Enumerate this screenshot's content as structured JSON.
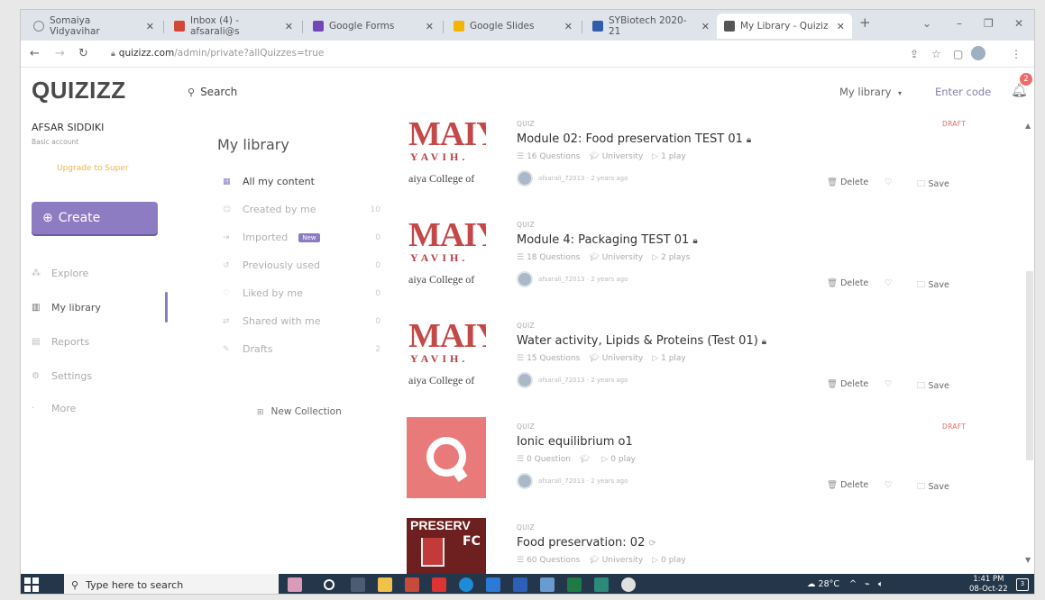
{
  "browser": {
    "tabs": [
      {
        "label": "Somaiya Vidyavihar",
        "color": "#888888"
      },
      {
        "label": "Inbox (4) - afsarali@s",
        "color": "#d44638"
      },
      {
        "label": "Google Forms",
        "color": "#7248b9"
      },
      {
        "label": "Google Slides",
        "color": "#f4b400"
      },
      {
        "label": "SYBiotech 2020-21",
        "color": "#2f5fa8"
      },
      {
        "label": "My Library - Quiziz",
        "color": "#555555"
      }
    ],
    "url_host": "quizizz.com",
    "url_path": "/admin/private?allQuizzes=true"
  },
  "header": {
    "logo": "QUIZIZZ",
    "search_placeholder": "Search",
    "my_library_label": "My library",
    "enter_code_label": "Enter code",
    "notif_count": "2"
  },
  "sidebar": {
    "user_name": "AFSAR SIDDIKI",
    "account_type": "Basic account",
    "upgrade_label": "Upgrade to Super",
    "create_label": "Create",
    "items": [
      {
        "label": "Explore"
      },
      {
        "label": "My library"
      },
      {
        "label": "Reports"
      },
      {
        "label": "Settings"
      },
      {
        "label": "More"
      }
    ]
  },
  "library": {
    "title": "My library",
    "items": [
      {
        "label": "All my content",
        "count": ""
      },
      {
        "label": "Created by me",
        "count": "10"
      },
      {
        "label": "Imported",
        "count": "0"
      },
      {
        "label": "Previously used",
        "count": "0"
      },
      {
        "label": "Liked by me",
        "count": "0"
      },
      {
        "label": "Shared with me",
        "count": "0"
      },
      {
        "label": "Drafts",
        "count": "2"
      }
    ],
    "new_badge": "New",
    "new_collection_label": "New Collection"
  },
  "quizzes": [
    {
      "type": "QUIZ",
      "title": "Module 02: Food preservation TEST 01",
      "questions": "16 Questions",
      "level": "University",
      "plays": "1 play",
      "author": "afsarali_72013 · 2 years ago",
      "draft": "DRAFT",
      "thumb_line1": "MAIY",
      "thumb_line2": "YAVIH.",
      "thumb_line3": "aiya College of"
    },
    {
      "type": "QUIZ",
      "title": "Module 4: Packaging TEST 01",
      "questions": "18 Questions",
      "level": "University",
      "plays": "2 plays",
      "author": "afsarali_72013 · 2 years ago",
      "draft": "",
      "thumb_line1": "MAIY",
      "thumb_line2": "YAVIH.",
      "thumb_line3": "aiya College of"
    },
    {
      "type": "QUIZ",
      "title": "Water activity, Lipids & Proteins (Test 01)",
      "questions": "15 Questions",
      "level": "University",
      "plays": "1 play",
      "author": "afsarali_72013 · 2 years ago",
      "draft": "",
      "thumb_line1": "MAIY",
      "thumb_line2": "YAVIH.",
      "thumb_line3": "aiya College of"
    },
    {
      "type": "QUIZ",
      "title": "Ionic equilibrium o1",
      "questions": "0 Question",
      "level": "",
      "plays": "0 play",
      "author": "afsarali_72013 · 2 years ago",
      "draft": "DRAFT"
    },
    {
      "type": "QUIZ",
      "title": "Food preservation: 02",
      "questions": "60 Questions",
      "level": "University",
      "plays": "0 play",
      "author": "",
      "draft": "",
      "thumb_line1": "PRESERV",
      "thumb_line2": "FC"
    }
  ],
  "actions": {
    "delete_label": "Delete",
    "save_label": "Save"
  },
  "taskbar": {
    "search_placeholder": "Type here to search",
    "weather": "28°C",
    "time": "1:41 PM",
    "date": "08-Oct-22"
  }
}
